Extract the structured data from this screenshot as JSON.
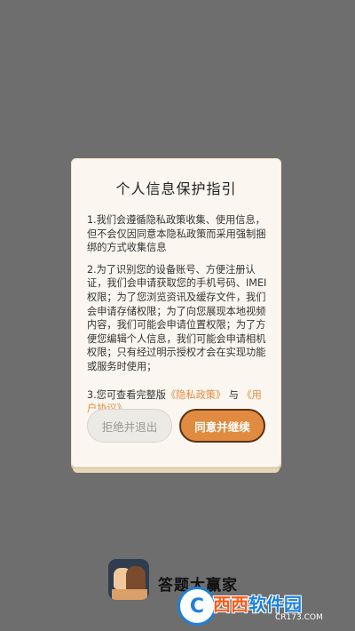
{
  "dialog": {
    "title": "个人信息保护指引",
    "p1": "1.我们会遵循隐私政策收集、使用信息，但不会仅因同意本隐私政策而采用强制捆绑的方式收集信息",
    "p2": "2.为了识别您的设备账号、方便注册认证，我们会申请获取您的手机号码、IMEI权限；为了您浏览资讯及缓存文件，我们会申请存储权限；为了向您展现本地视频内容，我们可能会申请位置权限；为了方便您编辑个人信息，我们可能会申请相机权限；只有经过明示授权才会在实现功能或服务时使用；",
    "p3_prefix": "3.您可查看完整版",
    "privacy_link": "《隐私政策》",
    "p3_and": "与",
    "user_link": "《用户协议》",
    "decline_label": "拒绝并退出",
    "agree_label": "同意并继续"
  },
  "app": {
    "name": "答题大赢家"
  },
  "watermark": {
    "brand_a": "西西",
    "brand_b": "软件园",
    "url": "CR173.COM"
  },
  "colors": {
    "background": "#6e6e6e",
    "accent": "#e08b3f",
    "link": "#e08a3c"
  }
}
